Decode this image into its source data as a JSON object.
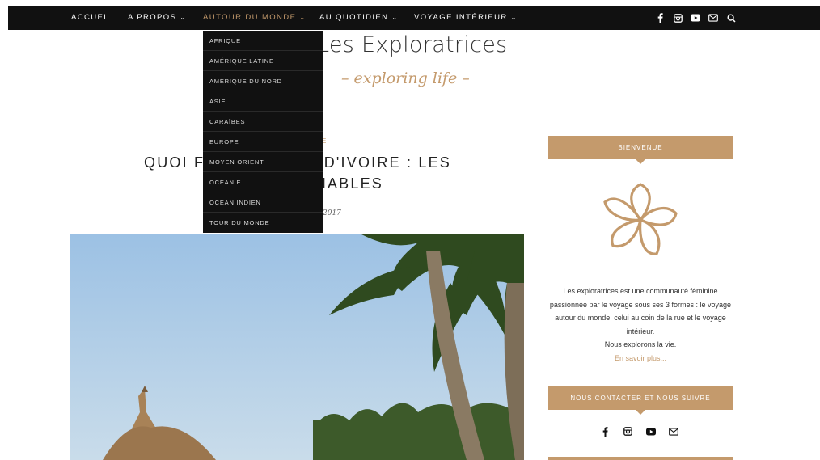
{
  "nav": {
    "items": [
      {
        "label": "ACCUEIL",
        "chevron": ""
      },
      {
        "label": "A PROPOS",
        "chevron": "⌄"
      },
      {
        "label": "AUTOUR DU MONDE",
        "chevron": "⌄"
      },
      {
        "label": "AU QUOTIDIEN",
        "chevron": "⌄"
      },
      {
        "label": "VOYAGE INTÉRIEUR",
        "chevron": "⌄"
      }
    ],
    "active_index": 2,
    "social_icons": [
      "facebook-icon",
      "instagram-icon",
      "youtube-icon",
      "mail-icon",
      "search-icon"
    ]
  },
  "brand": {
    "title": "Les Exploratrices",
    "tagline": "– exploring life –"
  },
  "dropdown": {
    "items": [
      "AFRIQUE",
      "AMÉRIQUE LATINE",
      "AMÉRIQUE DU NORD",
      "ASIE",
      "CARAÏBES",
      "EUROPE",
      "MOYEN ORIENT",
      "OCÉANIE",
      "OCEAN INDIEN",
      "TOUR DU MONDE"
    ]
  },
  "post": {
    "category_fragment": "E",
    "title_line1_left": "QUOI F",
    "title_line1_right": "D'IVOIRE : LES",
    "title_line2_right": "NABLES",
    "date_fragment": "2017"
  },
  "sidebar": {
    "welcome_title": "BIENVENUE",
    "about_text": "Les exploratrices est une communauté féminine passionnée par le voyage sous ses 3 formes : le voyage autour du monde, celui au coin de la rue et le voyage intérieur.",
    "about_text2": "Nous explorons la vie.",
    "about_link": "En savoir plus...",
    "contact_title": "NOUS CONTACTER ET NOUS SUIVRE",
    "follow_icons": [
      "facebook-icon",
      "instagram-icon",
      "youtube-icon",
      "mail-icon"
    ]
  },
  "colors": {
    "accent": "#c49a6c",
    "nav_bg": "#111111",
    "sky": "#a9c9e6"
  }
}
